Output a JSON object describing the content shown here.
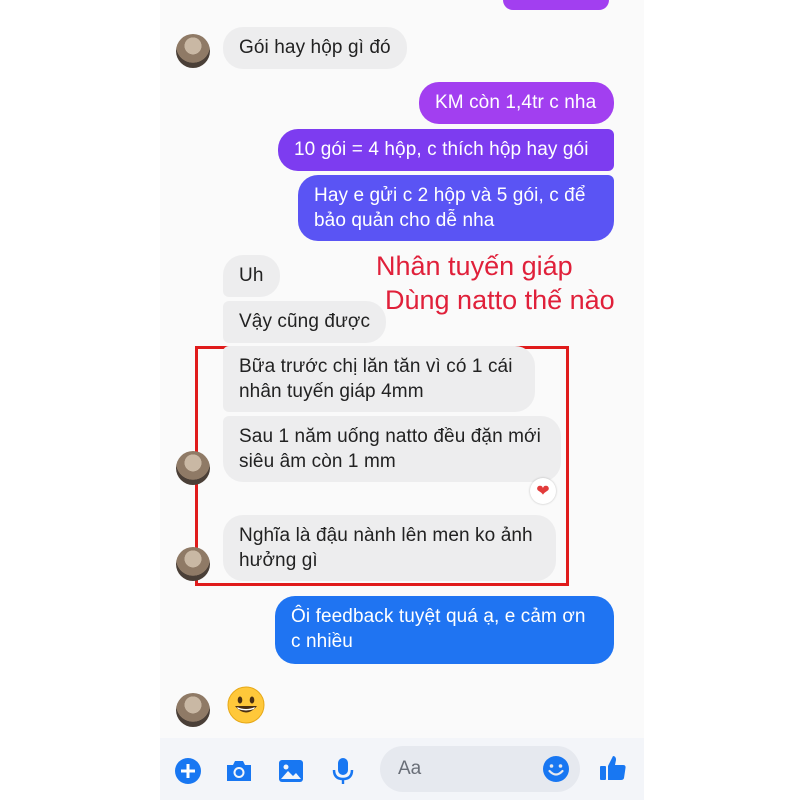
{
  "colors": {
    "incoming_bubble": "#ededee",
    "outgoing_gradient": [
      "#a23ff0",
      "#5a54f4"
    ],
    "outgoing_blue": "#1f74f2",
    "annotation_red": "#e01b1b",
    "messenger_blue": "#1877f2"
  },
  "messages": [
    {
      "text": "Gói hay hộp gì đó",
      "side": "incoming"
    },
    {
      "text": "KM còn 1,4tr c nha",
      "side": "outgoing"
    },
    {
      "text": "10 gói = 4 hộp, c thích hộp hay gói",
      "side": "outgoing"
    },
    {
      "lines": [
        "Hay e gửi c 2 hộp và 5 gói, c để",
        "bảo quản cho dễ nha"
      ],
      "side": "outgoing"
    },
    {
      "text": "Uh",
      "side": "incoming"
    },
    {
      "text": "Vậy cũng được",
      "side": "incoming"
    },
    {
      "lines": [
        "Bữa trước chị lăn tăn vì có 1 cái",
        "nhân tuyến giáp 4mm"
      ],
      "side": "incoming"
    },
    {
      "lines": [
        "Sau 1 năm uống natto đều đặn mới",
        "siêu âm còn 1 mm"
      ],
      "side": "incoming",
      "reaction": "heart"
    },
    {
      "lines": [
        "Nghĩa là đậu nành lên men ko ảnh",
        "hưởng gì"
      ],
      "side": "incoming"
    },
    {
      "lines": [
        "Ôi feedback tuyệt quá ạ, e cảm ơn",
        "c nhiều"
      ],
      "side": "outgoing"
    },
    {
      "emoji": "grinning-face",
      "side": "incoming"
    }
  ],
  "overlay": {
    "line1": "Nhân tuyến giáp",
    "line2": "Dùng natto thế nào"
  },
  "composer": {
    "placeholder": "Aa",
    "icons": [
      "plus-icon",
      "camera-icon",
      "image-icon",
      "microphone-icon",
      "emoji-icon",
      "thumbs-up-icon"
    ]
  }
}
